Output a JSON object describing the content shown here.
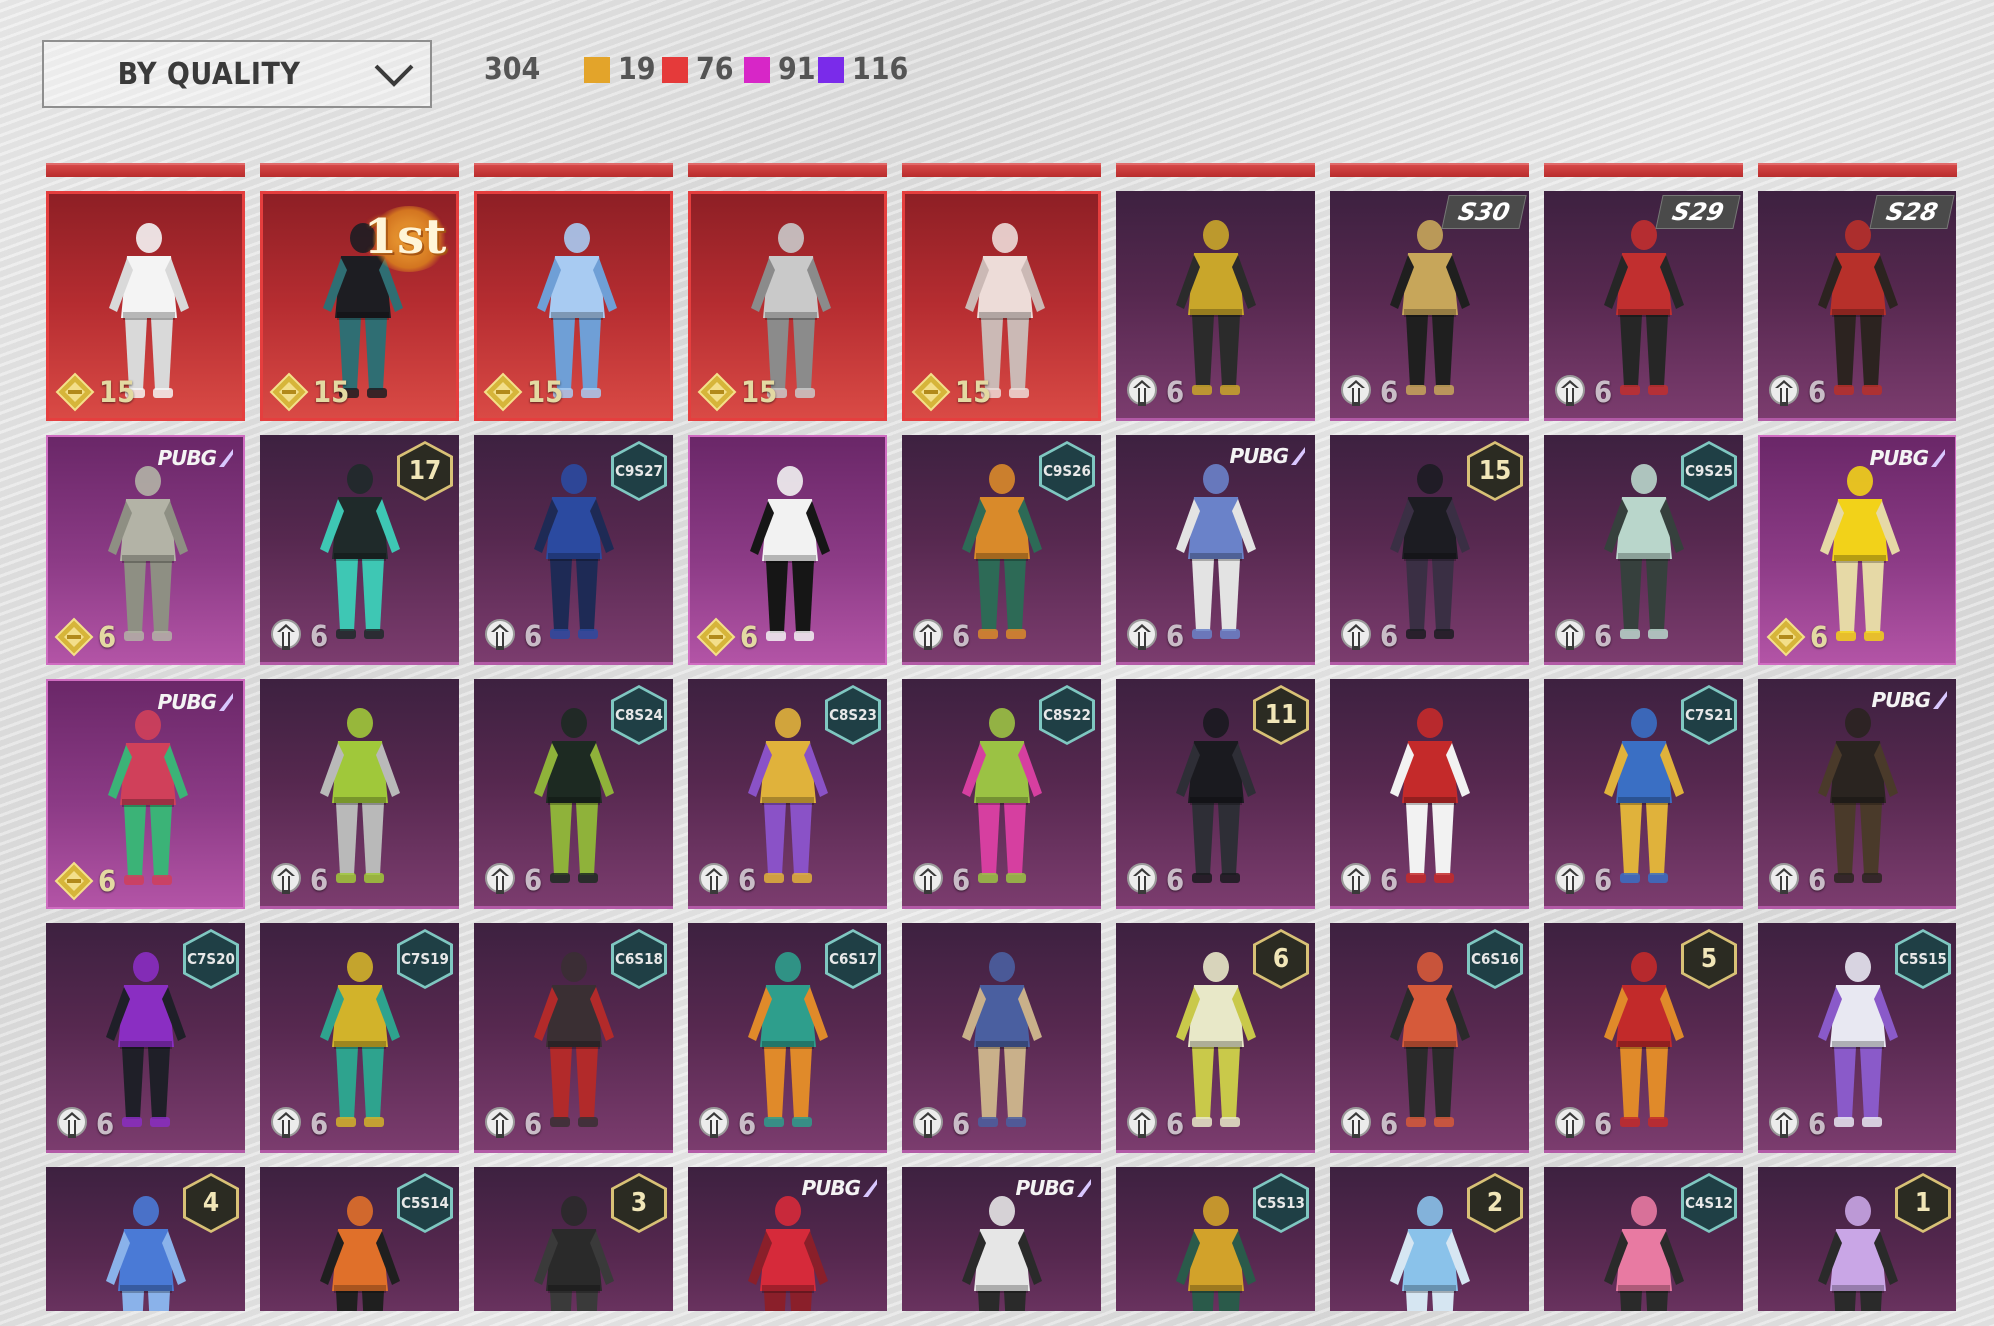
{
  "sort": {
    "label": "BY QUALITY"
  },
  "counts": {
    "total": "304",
    "qualities": [
      {
        "name": "gold",
        "color": "#e3a42a",
        "count": "19"
      },
      {
        "name": "red",
        "color": "#e53a3a",
        "count": "76"
      },
      {
        "name": "pink",
        "color": "#d726c7",
        "count": "91"
      },
      {
        "name": "violet",
        "color": "#7a2bea",
        "count": "116"
      }
    ]
  },
  "items": [
    {
      "quality": "mythic",
      "currency": "gold",
      "value": "15",
      "badge_type": "none",
      "badge": "",
      "palette": [
        "#f4f4f4",
        "#d9d9d9"
      ]
    },
    {
      "quality": "mythic",
      "currency": "gold",
      "value": "15",
      "badge_type": "first",
      "badge": "1st",
      "palette": [
        "#1d1d22",
        "#2f6e73"
      ]
    },
    {
      "quality": "mythic",
      "currency": "gold",
      "value": "15",
      "badge_type": "none",
      "badge": "",
      "palette": [
        "#a8cbf2",
        "#6f9fd6"
      ]
    },
    {
      "quality": "mythic",
      "currency": "gold",
      "value": "15",
      "badge_type": "none",
      "badge": "",
      "palette": [
        "#c9c9c9",
        "#8b8b8b"
      ]
    },
    {
      "quality": "mythic",
      "currency": "gold",
      "value": "15",
      "badge_type": "none",
      "badge": "",
      "palette": [
        "#eddcd8",
        "#cbb9b5"
      ]
    },
    {
      "quality": "purple",
      "currency": "silver",
      "value": "6",
      "badge_type": "none",
      "badge": "",
      "palette": [
        "#c9a62a",
        "#2b2b2b"
      ]
    },
    {
      "quality": "purple",
      "currency": "silver",
      "value": "6",
      "badge_type": "season",
      "badge": "S30",
      "palette": [
        "#c7a65a",
        "#1f1f1f"
      ]
    },
    {
      "quality": "purple",
      "currency": "silver",
      "value": "6",
      "badge_type": "season",
      "badge": "S29",
      "palette": [
        "#c12f2f",
        "#262626"
      ]
    },
    {
      "quality": "purple",
      "currency": "silver",
      "value": "6",
      "badge_type": "season",
      "badge": "S28",
      "palette": [
        "#b7302a",
        "#2c2320"
      ]
    },
    {
      "quality": "legend",
      "currency": "gold",
      "value": "6",
      "badge_type": "logo",
      "badge": "PUBG",
      "palette": [
        "#b3b3a6",
        "#8e8f83"
      ]
    },
    {
      "quality": "purple",
      "currency": "silver",
      "value": "6",
      "badge_type": "rank",
      "badge": "17",
      "palette": [
        "#1f2a2a",
        "#3ec7b4"
      ]
    },
    {
      "quality": "purple",
      "currency": "silver",
      "value": "6",
      "badge_type": "code",
      "badge": "C9S27",
      "palette": [
        "#2b4aa0",
        "#1e2a55"
      ]
    },
    {
      "quality": "legend",
      "currency": "gold",
      "value": "6",
      "badge_type": "none",
      "badge": "",
      "palette": [
        "#f2f2f2",
        "#161616"
      ]
    },
    {
      "quality": "purple",
      "currency": "silver",
      "value": "6",
      "badge_type": "code",
      "badge": "C9S26",
      "palette": [
        "#d98a2a",
        "#2d6a56"
      ]
    },
    {
      "quality": "purple",
      "currency": "silver",
      "value": "6",
      "badge_type": "logo",
      "badge": "PUBG",
      "palette": [
        "#6a82c9",
        "#e3e3e3"
      ]
    },
    {
      "quality": "purple",
      "currency": "silver",
      "value": "6",
      "badge_type": "rank",
      "badge": "15",
      "palette": [
        "#1c1c22",
        "#3a2f44"
      ]
    },
    {
      "quality": "purple",
      "currency": "silver",
      "value": "6",
      "badge_type": "code",
      "badge": "C9S25",
      "palette": [
        "#b9d6cb",
        "#36403d"
      ]
    },
    {
      "quality": "legend",
      "currency": "gold",
      "value": "6",
      "badge_type": "logo",
      "badge": "PUBG",
      "palette": [
        "#f2d219",
        "#e6d9a6"
      ]
    },
    {
      "quality": "legend",
      "currency": "gold",
      "value": "6",
      "badge_type": "logo",
      "badge": "PUBG",
      "palette": [
        "#d0405a",
        "#3bb377"
      ]
    },
    {
      "quality": "purple",
      "currency": "silver",
      "value": "6",
      "badge_type": "none",
      "badge": "",
      "palette": [
        "#a0c83a",
        "#b9b9b9"
      ]
    },
    {
      "quality": "purple",
      "currency": "silver",
      "value": "6",
      "badge_type": "code",
      "badge": "C8S24",
      "palette": [
        "#1d2a22",
        "#8fb23a"
      ]
    },
    {
      "quality": "purple",
      "currency": "silver",
      "value": "6",
      "badge_type": "code",
      "badge": "C8S23",
      "palette": [
        "#e0b23b",
        "#8a52c7"
      ]
    },
    {
      "quality": "purple",
      "currency": "silver",
      "value": "6",
      "badge_type": "code",
      "badge": "C8S22",
      "palette": [
        "#9bc244",
        "#d63fa0"
      ]
    },
    {
      "quality": "purple",
      "currency": "silver",
      "value": "6",
      "badge_type": "rank",
      "badge": "11",
      "palette": [
        "#1a1a1f",
        "#2e2e36"
      ]
    },
    {
      "quality": "purple",
      "currency": "silver",
      "value": "6",
      "badge_type": "none",
      "badge": "",
      "palette": [
        "#c42a2a",
        "#f2f2f2"
      ]
    },
    {
      "quality": "purple",
      "currency": "silver",
      "value": "6",
      "badge_type": "code",
      "badge": "C7S21",
      "palette": [
        "#3a6fc4",
        "#e0b23b"
      ]
    },
    {
      "quality": "purple",
      "currency": "silver",
      "value": "6",
      "badge_type": "logo",
      "badge": "PUBG",
      "palette": [
        "#2a2420",
        "#4a3a2a"
      ]
    },
    {
      "quality": "purple",
      "currency": "silver",
      "value": "6",
      "badge_type": "code",
      "badge": "C7S20",
      "palette": [
        "#8a2ec2",
        "#1f1f28"
      ]
    },
    {
      "quality": "purple",
      "currency": "silver",
      "value": "6",
      "badge_type": "code",
      "badge": "C7S19",
      "palette": [
        "#d2b32a",
        "#2ea38e"
      ]
    },
    {
      "quality": "purple",
      "currency": "silver",
      "value": "6",
      "badge_type": "code",
      "badge": "C6S18",
      "palette": [
        "#3a2f33",
        "#b22a2a"
      ]
    },
    {
      "quality": "purple",
      "currency": "silver",
      "value": "6",
      "badge_type": "code",
      "badge": "C6S17",
      "palette": [
        "#2e9e8c",
        "#e08a2a"
      ]
    },
    {
      "quality": "purple",
      "currency": "silver",
      "value": "6",
      "badge_type": "none",
      "badge": "",
      "palette": [
        "#4a5fa0",
        "#c9b08a"
      ]
    },
    {
      "quality": "purple",
      "currency": "silver",
      "value": "6",
      "badge_type": "rank",
      "badge": "6",
      "palette": [
        "#e8e8c8",
        "#c9c94a"
      ]
    },
    {
      "quality": "purple",
      "currency": "silver",
      "value": "6",
      "badge_type": "code",
      "badge": "C6S16",
      "palette": [
        "#d65a3a",
        "#2a2a2a"
      ]
    },
    {
      "quality": "purple",
      "currency": "silver",
      "value": "6",
      "badge_type": "rank",
      "badge": "5",
      "palette": [
        "#c22a2a",
        "#e08a2a"
      ]
    },
    {
      "quality": "purple",
      "currency": "silver",
      "value": "6",
      "badge_type": "code",
      "badge": "C5S15",
      "palette": [
        "#e8e8f2",
        "#8a5ac9"
      ]
    },
    {
      "quality": "purple",
      "currency": "silver",
      "value": "",
      "badge_type": "rank",
      "badge": "4",
      "palette": [
        "#4a7ad6",
        "#8ab2ea"
      ]
    },
    {
      "quality": "purple",
      "currency": "silver",
      "value": "",
      "badge_type": "code",
      "badge": "C5S14",
      "palette": [
        "#e0702a",
        "#1f1f1f"
      ]
    },
    {
      "quality": "purple",
      "currency": "silver",
      "value": "",
      "badge_type": "rank",
      "badge": "3",
      "palette": [
        "#2a2a2a",
        "#3a3a3a"
      ]
    },
    {
      "quality": "purple",
      "currency": "silver",
      "value": "",
      "badge_type": "logo",
      "badge": "PUBG",
      "palette": [
        "#d62a3a",
        "#8a1f2a"
      ]
    },
    {
      "quality": "purple",
      "currency": "silver",
      "value": "",
      "badge_type": "logo",
      "badge": "PUBG",
      "palette": [
        "#e6e6e6",
        "#2a2a2a"
      ]
    },
    {
      "quality": "purple",
      "currency": "silver",
      "value": "",
      "badge_type": "code",
      "badge": "C5S13",
      "palette": [
        "#d2a22a",
        "#2a5a4a"
      ]
    },
    {
      "quality": "purple",
      "currency": "silver",
      "value": "",
      "badge_type": "rank",
      "badge": "2",
      "palette": [
        "#8ac2ea",
        "#d6e6f2"
      ]
    },
    {
      "quality": "purple",
      "currency": "silver",
      "value": "",
      "badge_type": "code",
      "badge": "C4S12",
      "palette": [
        "#e87aa2",
        "#2a2a2a"
      ]
    },
    {
      "quality": "purple",
      "currency": "silver",
      "value": "",
      "badge_type": "rank",
      "badge": "1",
      "palette": [
        "#c9a6e6",
        "#2a2a2a"
      ]
    }
  ]
}
